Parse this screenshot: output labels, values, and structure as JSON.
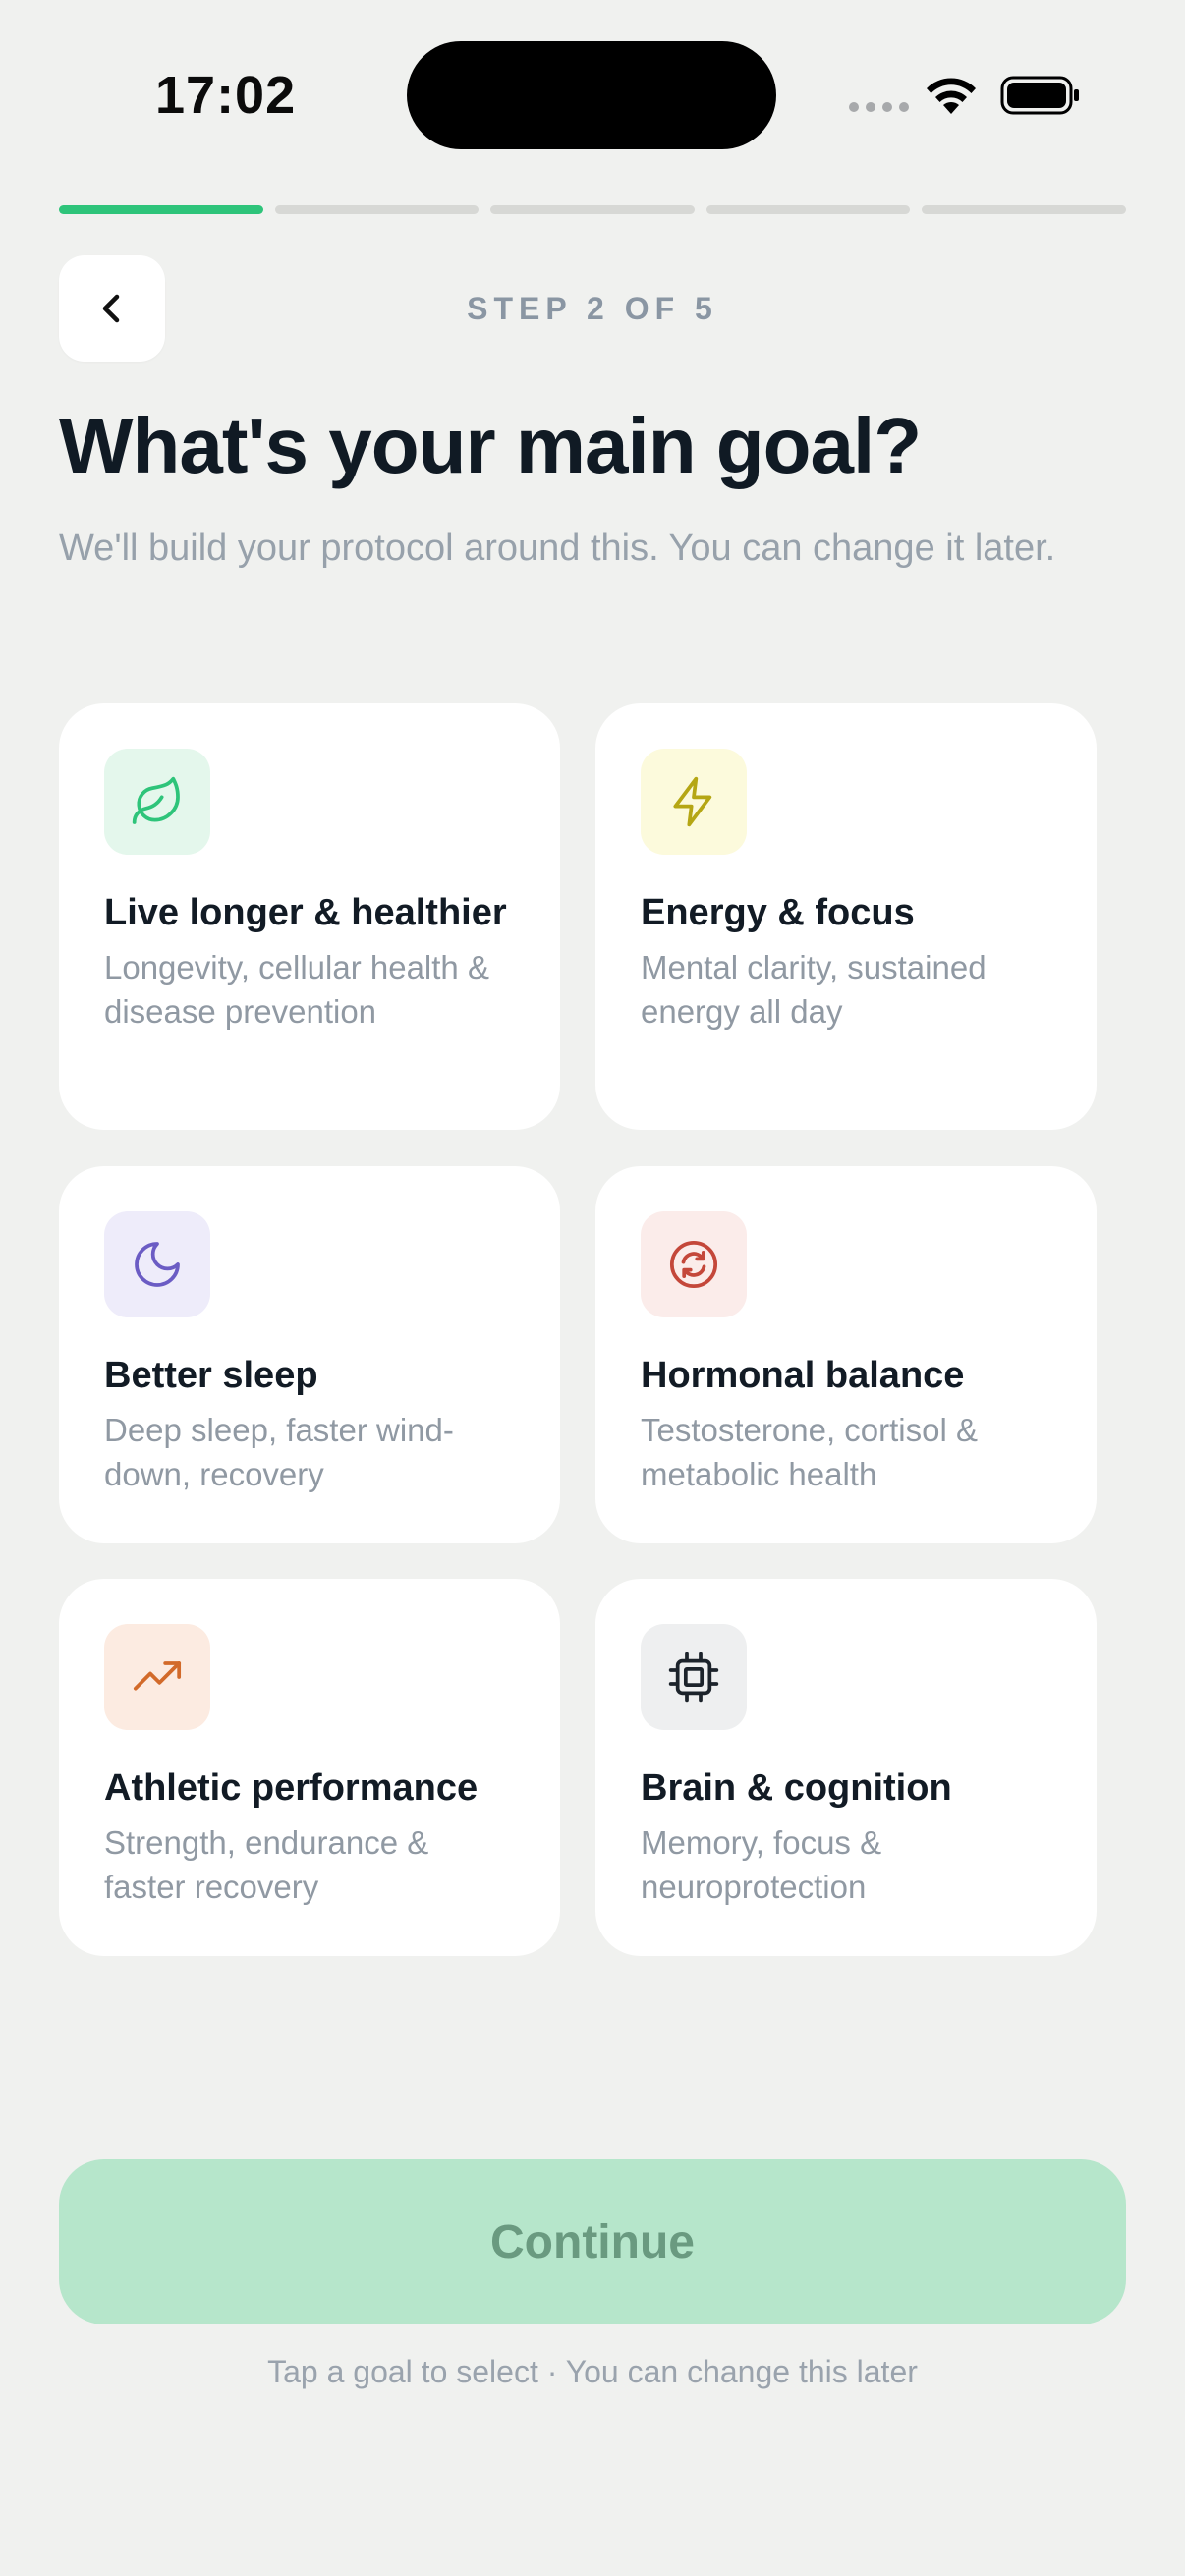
{
  "status": {
    "time": "17:02"
  },
  "header": {
    "step_label": "STEP 2 OF 5",
    "progress": {
      "current": 1,
      "total": 5
    }
  },
  "page": {
    "title": "What's your main goal?",
    "subtitle": "We'll build your protocol around this. You can change it later."
  },
  "goals": [
    {
      "title": "Live longer & healthier",
      "description": "Longevity, cellular health & disease prevention",
      "icon": "leaf-icon",
      "color": "#2ec47a",
      "bg": "#e4f7ec"
    },
    {
      "title": "Energy & focus",
      "description": "Mental clarity, sustained energy all day",
      "icon": "lightning-icon",
      "color": "#b5a614",
      "bg": "#fcfadc"
    },
    {
      "title": "Better sleep",
      "description": "Deep sleep, faster wind-down, recovery",
      "icon": "moon-icon",
      "color": "#6b5cc4",
      "bg": "#eeecfa"
    },
    {
      "title": "Hormonal balance",
      "description": "Testosterone, cortisol & metabolic health",
      "icon": "refresh-icon",
      "color": "#c4473a",
      "bg": "#fbecea"
    },
    {
      "title": "Athletic performance",
      "description": "Strength, endurance & faster recovery",
      "icon": "trending-up-icon",
      "color": "#d26a2a",
      "bg": "#fcebe1"
    },
    {
      "title": "Brain & cognition",
      "description": "Memory, focus & neuroprotection",
      "icon": "chip-icon",
      "color": "#1c232b",
      "bg": "#eeeff0"
    }
  ],
  "footer": {
    "continue_label": "Continue",
    "hint": "Tap a goal to select · You can change this later"
  }
}
